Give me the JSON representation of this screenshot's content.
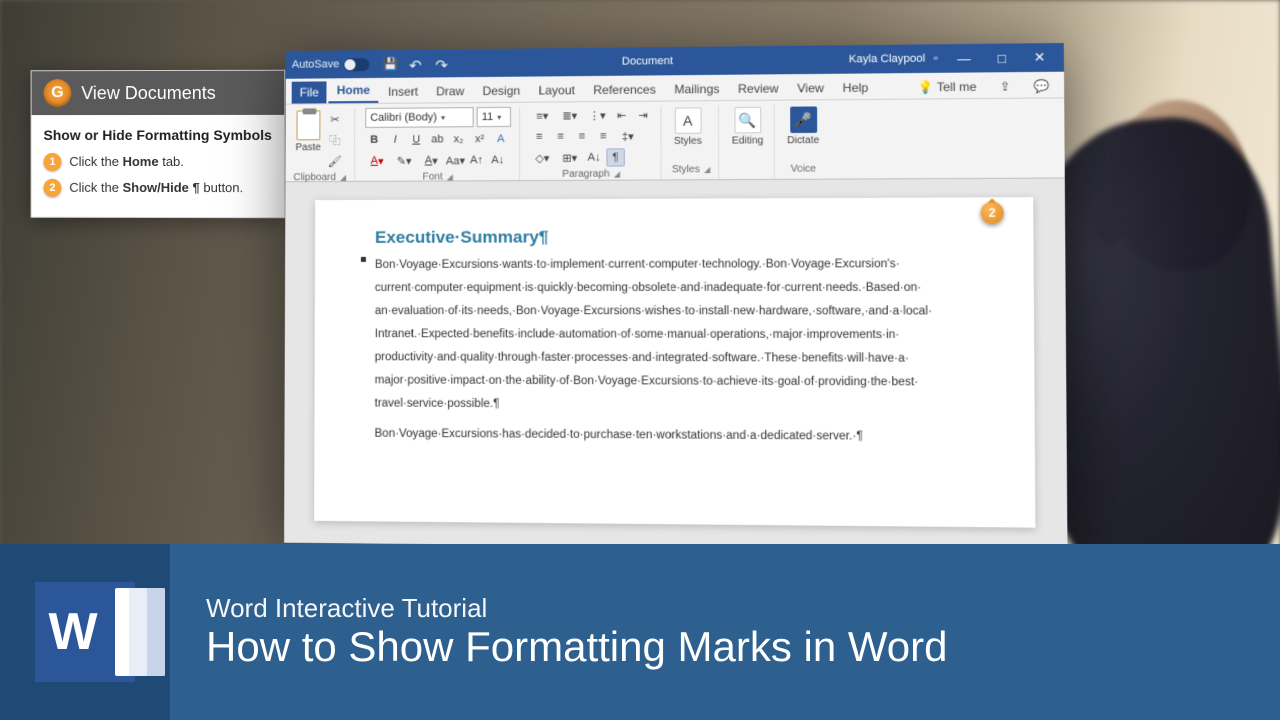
{
  "sidebar": {
    "header": "View Documents",
    "title": "Show or Hide Formatting Symbols",
    "steps": [
      {
        "num": "1",
        "prefix": "Click the ",
        "bold": "Home",
        "suffix": " tab."
      },
      {
        "num": "2",
        "prefix": "Click the ",
        "bold": "Show/Hide ¶",
        "suffix": " button."
      }
    ]
  },
  "word": {
    "titlebar": {
      "autosave": "AutoSave",
      "doc": "Document",
      "user": "Kayla Claypool"
    },
    "tabs": [
      "File",
      "Home",
      "Insert",
      "Draw",
      "Design",
      "Layout",
      "References",
      "Mailings",
      "Review",
      "View",
      "Help"
    ],
    "tellme": "Tell me",
    "active_tab": "Home",
    "ribbon": {
      "clipboard": {
        "label": "Clipboard",
        "paste": "Paste"
      },
      "font": {
        "label": "Font",
        "name": "Calibri (Body)",
        "size": "11"
      },
      "paragraph": {
        "label": "Paragraph"
      },
      "styles": {
        "label": "Styles",
        "btn": "Styles"
      },
      "editing": {
        "label": "",
        "btn": "Editing"
      },
      "voice": {
        "label": "Voice",
        "btn": "Dictate"
      }
    },
    "callout2": "2",
    "document": {
      "heading": "Executive·Summary¶",
      "para1": "Bon·Voyage·Excursions·wants·to·implement·current·computer·technology.·Bon·Voyage·Excursion's· current·computer·equipment·is·quickly·becoming·obsolete·and·inadequate·for·current·needs.·Based·on· an·evaluation·of·its·needs,·Bon·Voyage·Excursions·wishes·to·install·new·hardware,·software,·and·a·local· Intranet.·Expected·benefits·include·automation·of·some·manual·operations,·major·improvements·in· productivity·and·quality·through·faster·processes·and·integrated·software.·These·benefits·will·have·a· major·positive·impact·on·the·ability·of·Bon·Voyage·Excursions·to·achieve·its·goal·of·providing·the·best· travel·service·possible.¶",
      "para2": "Bon·Voyage·Excursions·has·decided·to·purchase·ten·workstations·and·a·dedicated·server.·¶"
    }
  },
  "banner": {
    "sub": "Word Interactive Tutorial",
    "title": "How to Show Formatting Marks in Word",
    "logo": "W"
  }
}
